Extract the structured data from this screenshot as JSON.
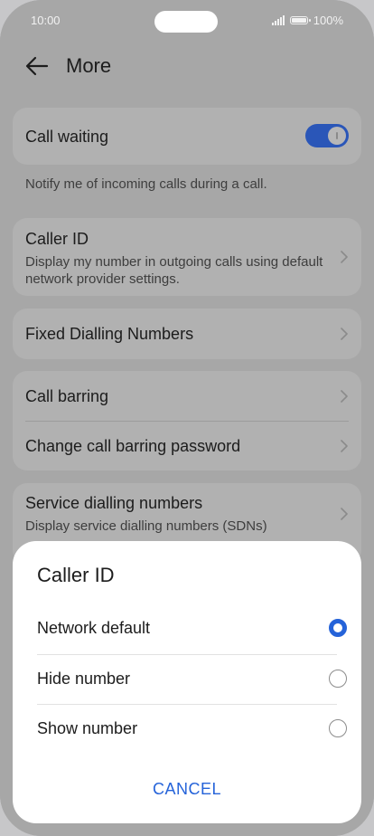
{
  "status_bar": {
    "time": "10:00",
    "battery": "100%"
  },
  "header": {
    "title": "More",
    "back_icon": "arrow-left-icon"
  },
  "settings": {
    "call_waiting": {
      "label": "Call waiting",
      "toggle_on": true,
      "hint": "Notify me of incoming calls during a call."
    },
    "caller_id": {
      "label": "Caller ID",
      "sub": "Display my number in outgoing calls using default network provider settings."
    },
    "fixed_dialling": {
      "label": "Fixed Dialling Numbers"
    },
    "call_barring": {
      "label": "Call barring"
    },
    "change_barring_password": {
      "label": "Change call barring password"
    },
    "service_dialling": {
      "label": "Service dialling numbers",
      "sub": "Display service dialling numbers (SDNs)"
    }
  },
  "dialog": {
    "title": "Caller ID",
    "options": [
      {
        "label": "Network default",
        "selected": true
      },
      {
        "label": "Hide number",
        "selected": false
      },
      {
        "label": "Show number",
        "selected": false
      }
    ],
    "cancel_label": "CANCEL"
  },
  "colors": {
    "accent": "#2563d9",
    "toggle_on": "#2a56b8",
    "dim_background": "#a7a7a7",
    "sheet": "#ffffff"
  }
}
